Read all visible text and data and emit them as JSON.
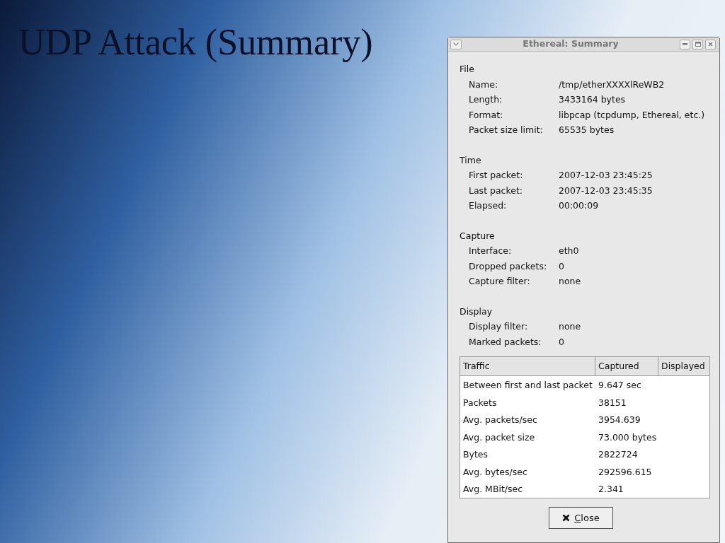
{
  "slide": {
    "title": "UDP Attack (Summary)"
  },
  "window": {
    "title": "Ethereal: Summary"
  },
  "sections": [
    {
      "heading": "File",
      "rows": [
        {
          "label": "Name:",
          "value": "/tmp/etherXXXXlReWB2"
        },
        {
          "label": "Length:",
          "value": "3433164 bytes"
        },
        {
          "label": "Format:",
          "value": "libpcap (tcpdump, Ethereal, etc.)"
        },
        {
          "label": "Packet size limit:",
          "value": "65535 bytes"
        }
      ]
    },
    {
      "heading": "Time",
      "rows": [
        {
          "label": "First packet:",
          "value": "2007-12-03 23:45:25"
        },
        {
          "label": "Last packet:",
          "value": "2007-12-03 23:45:35"
        },
        {
          "label": "Elapsed:",
          "value": "00:00:09"
        }
      ]
    },
    {
      "heading": "Capture",
      "rows": [
        {
          "label": "Interface:",
          "value": "eth0"
        },
        {
          "label": "Dropped packets:",
          "value": "0"
        },
        {
          "label": "Capture filter:",
          "value": "none"
        }
      ]
    },
    {
      "heading": "Display",
      "rows": [
        {
          "label": "Display filter:",
          "value": "none"
        },
        {
          "label": "Marked packets:",
          "value": "0"
        }
      ]
    }
  ],
  "table": {
    "columns": [
      "Traffic",
      "Captured",
      "Displayed"
    ],
    "rows": [
      [
        "Between first and last packet",
        "9.647 sec"
      ],
      [
        "Packets",
        "38151"
      ],
      [
        "Avg. packets/sec",
        "3954.639"
      ],
      [
        "Avg. packet size",
        "73.000 bytes"
      ],
      [
        "Bytes",
        "2822724"
      ],
      [
        "Avg. bytes/sec",
        "292596.615"
      ],
      [
        "Avg. MBit/sec",
        "2.341"
      ]
    ]
  },
  "buttons": [
    {
      "label": "Close"
    }
  ]
}
